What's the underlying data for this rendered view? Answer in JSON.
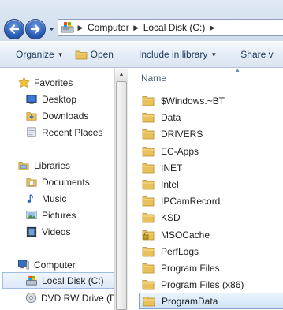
{
  "address_bar": {
    "crumbs": [
      "Computer",
      "Local Disk (C:)"
    ]
  },
  "command_bar": {
    "organize": "Organize",
    "open": "Open",
    "include_in_library": "Include in library",
    "share_with": "Share v"
  },
  "nav_pane": {
    "favorites": {
      "label": "Favorites",
      "items": [
        "Desktop",
        "Downloads",
        "Recent Places"
      ]
    },
    "libraries": {
      "label": "Libraries",
      "items": [
        "Documents",
        "Music",
        "Pictures",
        "Videos"
      ]
    },
    "computer": {
      "label": "Computer",
      "items": [
        "Local Disk (C:)",
        "DVD RW Drive (D"
      ]
    },
    "selected": "Local Disk (C:)"
  },
  "file_list": {
    "column_name": "Name",
    "items": [
      "$Windows.~BT",
      "Data",
      "DRIVERS",
      "EC-Apps",
      "INET",
      "Intel",
      "IPCamRecord",
      "KSD",
      "MSOCache",
      "PerfLogs",
      "Program Files",
      "Program Files (x86)",
      "ProgramData"
    ],
    "locked_item": "MSOCache",
    "selected": "ProgramData"
  },
  "colors": {
    "accent": "#2b5fb8",
    "selection_border": "#7da2ce",
    "folder": "#e8c15a"
  }
}
